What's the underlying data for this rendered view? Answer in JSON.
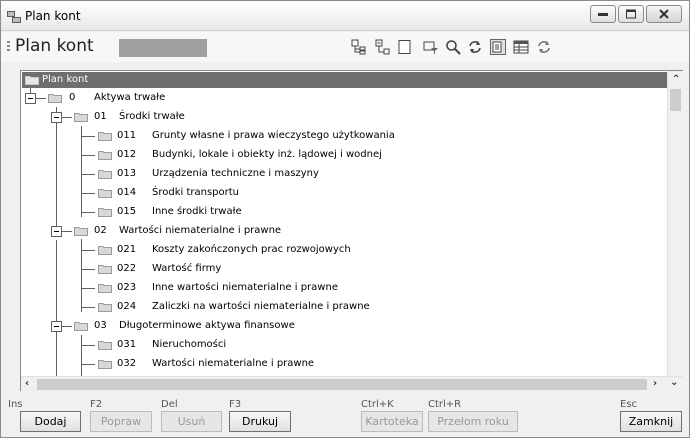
{
  "window": {
    "title": "Plan kont"
  },
  "header": {
    "title": "Plan kont"
  },
  "tree": {
    "root_label": "Plan kont",
    "rows": [
      {
        "code": "0",
        "name": "Aktywa trwałe"
      },
      {
        "code": "01",
        "name": "Środki trwałe"
      },
      {
        "code": "011",
        "name": "Grunty własne i prawa wieczystego użytkowania"
      },
      {
        "code": "012",
        "name": "Budynki, lokale i obiekty inż. lądowej i wodnej"
      },
      {
        "code": "013",
        "name": "Urządzenia techniczne i maszyny"
      },
      {
        "code": "014",
        "name": "Środki transportu"
      },
      {
        "code": "015",
        "name": "Inne środki trwałe"
      },
      {
        "code": "02",
        "name": "Wartości niematerialne i prawne"
      },
      {
        "code": "021",
        "name": "Koszty zakończonych prac rozwojowych"
      },
      {
        "code": "022",
        "name": "Wartość firmy"
      },
      {
        "code": "023",
        "name": "Inne wartości niematerialne i prawne"
      },
      {
        "code": "024",
        "name": "Zaliczki na wartości niematerialne i prawne"
      },
      {
        "code": "03",
        "name": "Długoterminowe aktywa finansowe"
      },
      {
        "code": "031",
        "name": "Nieruchomości"
      },
      {
        "code": "032",
        "name": "Wartości niematerialne i prawne"
      }
    ]
  },
  "buttons": {
    "add": {
      "hotkey": "Ins",
      "label": "Dodaj"
    },
    "edit": {
      "hotkey": "F2",
      "label": "Popraw"
    },
    "delete": {
      "hotkey": "Del",
      "label": "Usuń"
    },
    "print": {
      "hotkey": "F3",
      "label": "Drukuj"
    },
    "card": {
      "hotkey": "Ctrl+K",
      "label": "Kartoteka"
    },
    "year_end": {
      "hotkey": "Ctrl+R",
      "label": "Przełom roku"
    },
    "close": {
      "hotkey": "Esc",
      "label": "Zamknij"
    }
  },
  "colors": {
    "tree_header_bg": "#6e6e6e",
    "placeholder_field": "#a0a0a0",
    "folder": "#d8d8d8"
  }
}
